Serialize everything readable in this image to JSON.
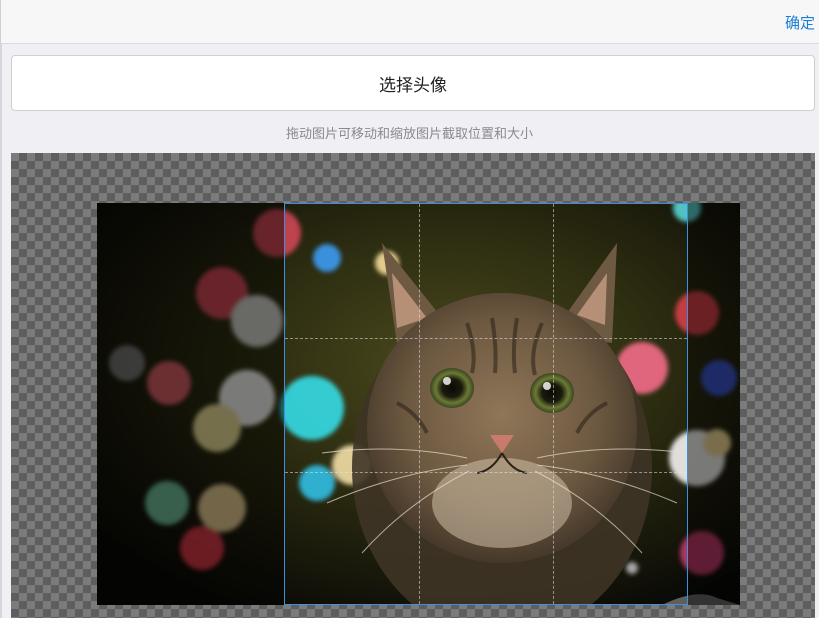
{
  "header": {
    "confirm_label": "确定"
  },
  "select_button": {
    "label": "选择头像"
  },
  "hint_text": "拖动图片可移动和缩放图片截取位置和大小",
  "cropper": {
    "image_subject": "tabby cat with bokeh lights",
    "accent_color": "#3d8fe0"
  }
}
